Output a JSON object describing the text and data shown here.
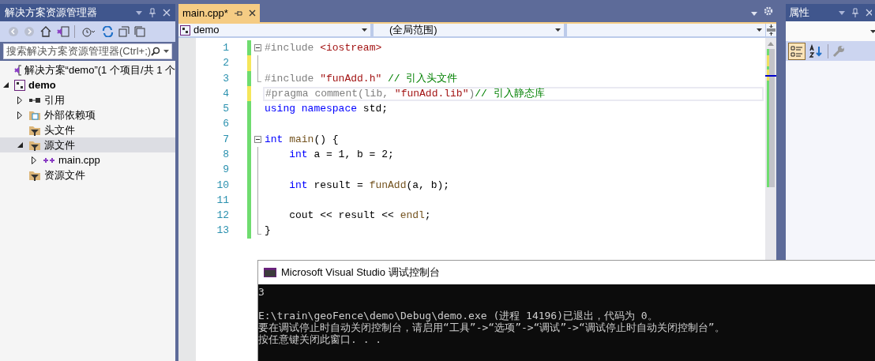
{
  "solution_explorer": {
    "title": "解决方案资源管理器",
    "search": {
      "placeholder": "搜索解决方案资源管理器(Ctrl+;)"
    },
    "tree": [
      {
        "label": "解决方案“demo”(1 个项目/共 1 个",
        "kind": "solution",
        "selected": false,
        "children": [
          {
            "label": "demo",
            "kind": "project",
            "expanded": true,
            "selected": false,
            "children": [
              {
                "label": "引用",
                "kind": "references",
                "expanded": false,
                "selected": false
              },
              {
                "label": "外部依赖项",
                "kind": "external",
                "expanded": false,
                "selected": false
              },
              {
                "label": "头文件",
                "kind": "filter",
                "selected": false
              },
              {
                "label": "源文件",
                "kind": "filter",
                "expanded": true,
                "selected": true,
                "children": [
                  {
                    "label": "main.cpp",
                    "kind": "cpp",
                    "expanded": false,
                    "selected": false
                  }
                ]
              },
              {
                "label": "资源文件",
                "kind": "filter",
                "selected": false
              }
            ]
          }
        ]
      }
    ]
  },
  "editor": {
    "tab": {
      "label": "main.cpp*",
      "selected": true
    },
    "nav": {
      "project": "demo",
      "scope": "(全局范围)"
    },
    "lines": [
      {
        "number": "1",
        "saved": true,
        "fold_start": true,
        "fold_end": false,
        "current": false,
        "tokens": [
          {
            "kind": "pp",
            "text": "#include "
          },
          {
            "kind": "str",
            "text": "<iostream>"
          }
        ]
      },
      {
        "number": "2",
        "saved": false,
        "fold_start": false,
        "fold_end": false,
        "current": false
      },
      {
        "number": "3",
        "saved": true,
        "fold_start": false,
        "fold_end": true,
        "current": false,
        "tokens": [
          {
            "kind": "pp",
            "text": "#include "
          },
          {
            "kind": "str",
            "text": "\"funAdd.h\""
          },
          {
            "kind": "cmt",
            "text": " // 引入头文件"
          }
        ]
      },
      {
        "number": "4",
        "saved": false,
        "fold_start": false,
        "fold_end": false,
        "current": true,
        "tokens": [
          {
            "kind": "pp",
            "text": "#pragma comment(lib, "
          },
          {
            "kind": "str",
            "text": "\"funAdd.lib\""
          },
          {
            "kind": "pp",
            "text": ")"
          },
          {
            "kind": "cmt",
            "text": "// 引入静态库"
          }
        ]
      },
      {
        "number": "5",
        "saved": true,
        "fold_start": false,
        "fold_end": false,
        "current": false,
        "tokens": [
          {
            "kind": "kw",
            "text": "using namespace"
          },
          {
            "kind": "plain",
            "text": " std;"
          }
        ]
      },
      {
        "number": "6",
        "saved": true,
        "fold_start": false,
        "fold_end": false,
        "current": false
      },
      {
        "number": "7",
        "saved": true,
        "fold_start": true,
        "fold_end": false,
        "current": false,
        "tokens": [
          {
            "kind": "kw",
            "text": "int"
          },
          {
            "kind": "fn",
            "text": " main"
          },
          {
            "kind": "plain",
            "text": "() {"
          }
        ]
      },
      {
        "number": "8",
        "saved": true,
        "fold_start": false,
        "fold_end": false,
        "current": false,
        "tokens": [
          {
            "kind": "kw",
            "text": "    int"
          },
          {
            "kind": "plain",
            "text": " a = 1, b = 2;"
          }
        ]
      },
      {
        "number": "9",
        "saved": true,
        "fold_start": false,
        "fold_end": false,
        "current": false
      },
      {
        "number": "10",
        "saved": true,
        "fold_start": false,
        "fold_end": false,
        "current": false,
        "tokens": [
          {
            "kind": "kw",
            "text": "    int"
          },
          {
            "kind": "plain",
            "text": " result = "
          },
          {
            "kind": "fn",
            "text": "funAdd"
          },
          {
            "kind": "plain",
            "text": "(a, b);"
          }
        ]
      },
      {
        "number": "11",
        "saved": true,
        "fold_start": false,
        "fold_end": false,
        "current": false
      },
      {
        "number": "12",
        "saved": true,
        "fold_start": false,
        "fold_end": false,
        "current": false,
        "tokens": [
          {
            "kind": "plain",
            "text": "    cout << result << "
          },
          {
            "kind": "fn",
            "text": "endl"
          },
          {
            "kind": "plain",
            "text": ";"
          }
        ]
      },
      {
        "number": "13",
        "saved": true,
        "fold_start": false,
        "fold_end": true,
        "current": false,
        "tokens": [
          {
            "kind": "plain",
            "text": "}"
          }
        ]
      }
    ]
  },
  "properties": {
    "title": "属性"
  },
  "console": {
    "title": "Microsoft Visual Studio 调试控制台",
    "lines": [
      {
        "kind": "text",
        "text": "3"
      },
      {
        "kind": "blank"
      },
      {
        "kind": "text",
        "text": "E:\\train\\geoFence\\demo\\Debug\\demo.exe (进程 14196)已退出，代码为 0。"
      },
      {
        "kind": "text",
        "text": "要在调试停止时自动关闭控制台，请启用“工具”->“选项”->“调试”->“调试停止时自动关闭控制台”。"
      },
      {
        "kind": "text",
        "text": "按任意键关闭此窗口. . ."
      }
    ]
  }
}
